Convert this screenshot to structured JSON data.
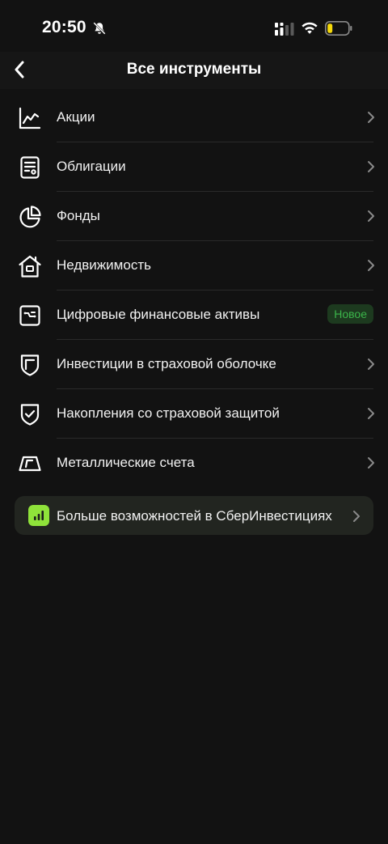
{
  "status_bar": {
    "time": "20:50",
    "icons": [
      "bell-slash-icon",
      "signal-icon",
      "wifi-icon",
      "battery-low-icon"
    ],
    "battery_color": "#f5d90a"
  },
  "header": {
    "title": "Все инструменты",
    "back_icon": "chevron-left-icon"
  },
  "instruments": [
    {
      "label": "Акции",
      "icon": "line-chart-icon",
      "trailing": "chevron"
    },
    {
      "label": "Облигации",
      "icon": "document-bond-icon",
      "trailing": "chevron"
    },
    {
      "label": "Фонды",
      "icon": "pie-chart-icon",
      "trailing": "chevron"
    },
    {
      "label": "Недвижимость",
      "icon": "house-icon",
      "trailing": "chevron"
    },
    {
      "label": "Цифровые финансовые активы",
      "icon": "digital-asset-icon",
      "trailing": "badge",
      "badge": "Новое"
    },
    {
      "label": "Инвестиции в страховой оболочке",
      "icon": "shield-icon",
      "trailing": "chevron"
    },
    {
      "label": "Накопления со страховой защитой",
      "icon": "shield-check-icon",
      "trailing": "chevron"
    },
    {
      "label": "Металлические счета",
      "icon": "metal-bar-icon",
      "trailing": "chevron"
    }
  ],
  "promo": {
    "label": "Больше возможностей в СберИнвестициях",
    "icon": "sber-investments-icon",
    "accent": "#8fe23a"
  },
  "colors": {
    "background": "#121212",
    "badge_text": "#3bb54a",
    "badge_bg": "#1d3a1f"
  }
}
